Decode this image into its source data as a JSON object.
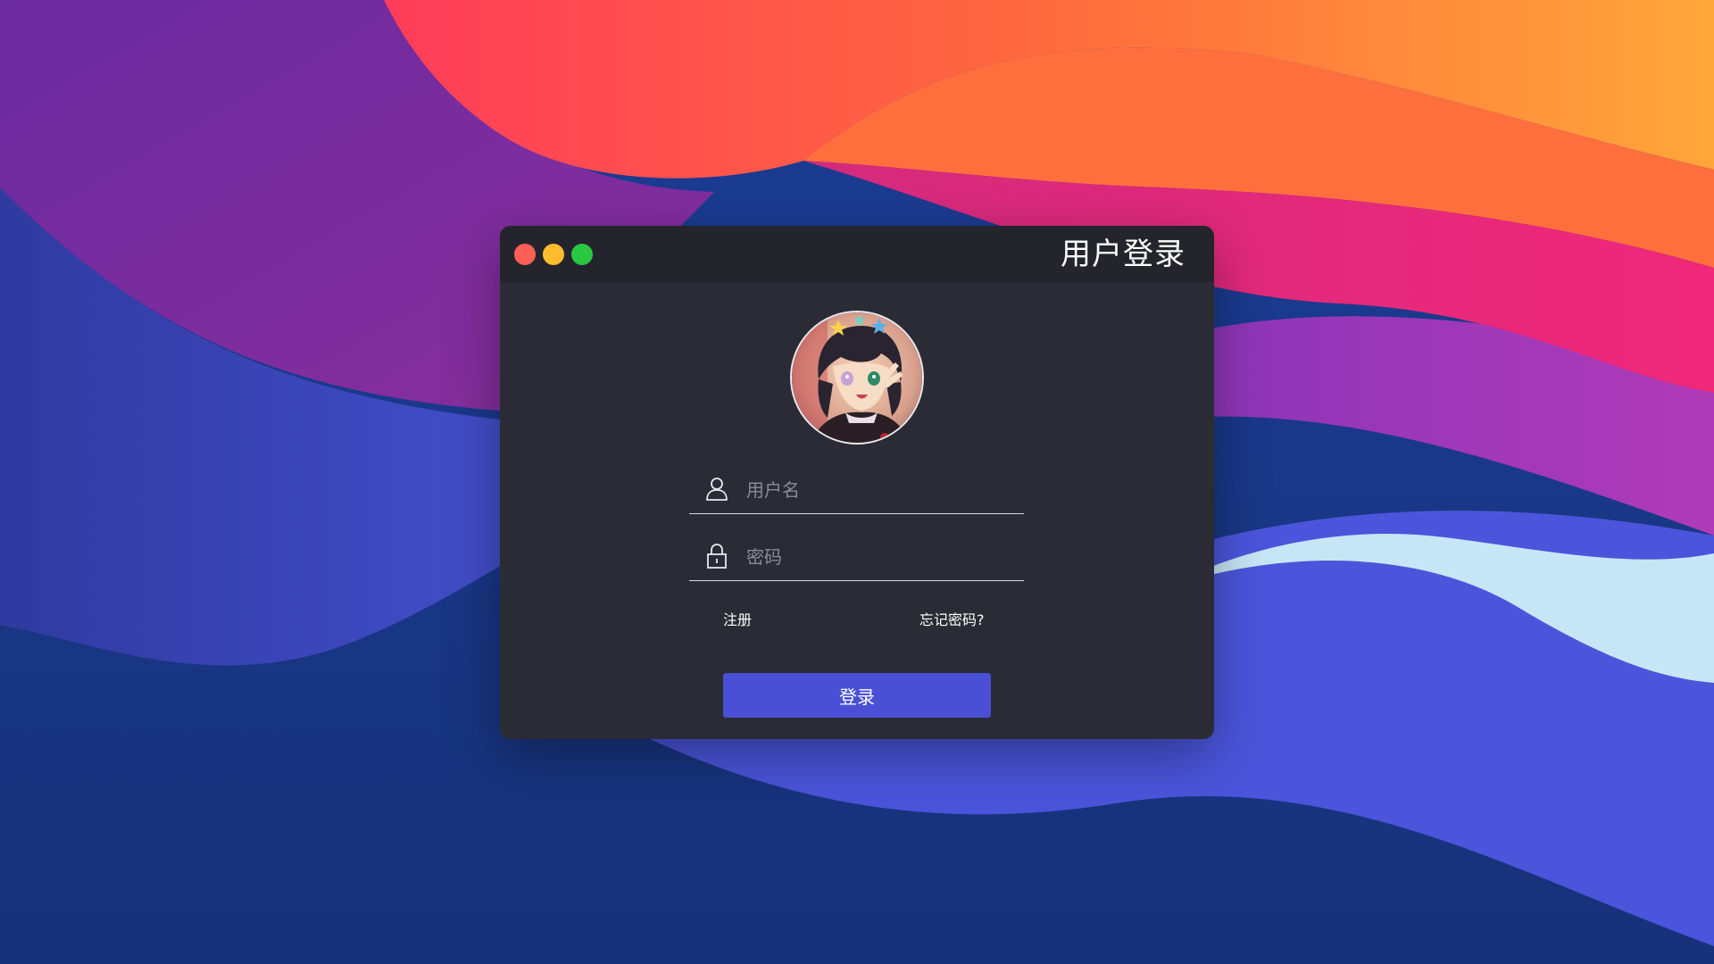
{
  "window": {
    "title": "用户登录",
    "buttons": {
      "close_color": "#ff5f57",
      "minimize_color": "#febc2e",
      "maximize_color": "#28c840"
    }
  },
  "avatar": {
    "description_icon": "anime-avatar"
  },
  "form": {
    "username": {
      "placeholder": "用户名",
      "value": "",
      "icon": "user-icon"
    },
    "password": {
      "placeholder": "密码",
      "value": "",
      "icon": "lock-icon"
    },
    "register_label": "注册",
    "forgot_label": "忘记密码?",
    "login_label": "登录"
  },
  "colors": {
    "window_bg": "#2b2b35",
    "titlebar_bg": "#24242d",
    "accent": "#4a50d6"
  }
}
